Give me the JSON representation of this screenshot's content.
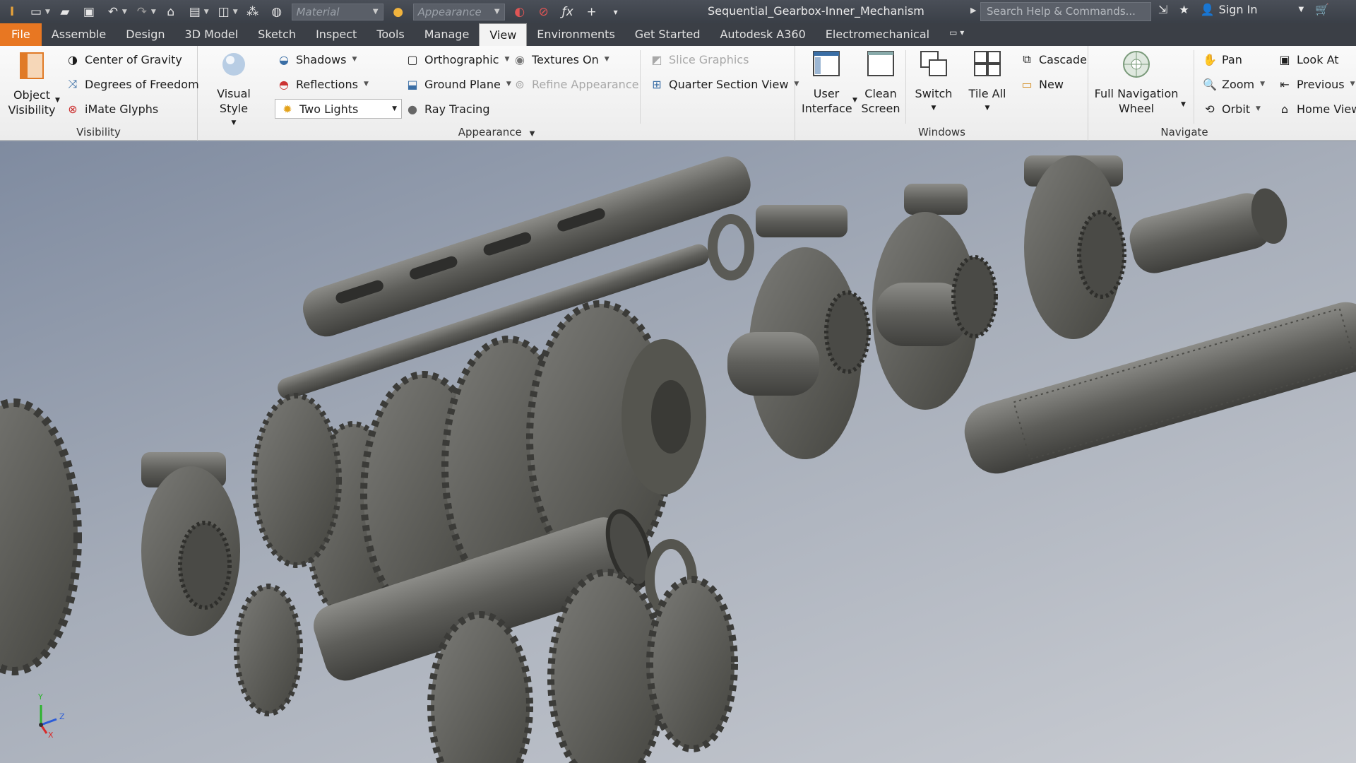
{
  "window": {
    "document_title": "Sequential_Gearbox-Inner_Mechanism",
    "search_placeholder": "Search Help & Commands...",
    "sign_in": "Sign In"
  },
  "quick_access": {
    "material_placeholder": "Material",
    "appearance_placeholder": "Appearance",
    "icons": [
      "app-logo-icon",
      "new-file-icon",
      "open-icon",
      "save-icon",
      "undo-icon",
      "redo-icon",
      "home-icon",
      "print-icon",
      "measure-icon",
      "select-icon",
      "globe-icon",
      "color-wheel-icon",
      "adjust-icon",
      "clear-icon",
      "fx-icon",
      "plus-icon",
      "customize-icon"
    ]
  },
  "tabs": [
    {
      "label": "File"
    },
    {
      "label": "Assemble"
    },
    {
      "label": "Design"
    },
    {
      "label": "3D Model"
    },
    {
      "label": "Sketch"
    },
    {
      "label": "Inspect"
    },
    {
      "label": "Tools"
    },
    {
      "label": "Manage"
    },
    {
      "label": "View"
    },
    {
      "label": "Environments"
    },
    {
      "label": "Get Started"
    },
    {
      "label": "Autodesk A360"
    },
    {
      "label": "Electromechanical"
    }
  ],
  "active_tab": "View",
  "ribbon": {
    "visibility": {
      "label": "Visibility",
      "object_visibility": "Object",
      "object_visibility_2": "Visibility",
      "center_of_gravity": "Center of Gravity",
      "degrees_of_freedom": "Degrees of Freedom",
      "imate_glyphs": "iMate Glyphs"
    },
    "appearance": {
      "label": "Appearance",
      "visual_style": "Visual Style",
      "shadows": "Shadows",
      "reflections": "Reflections",
      "lighting": "Two Lights",
      "orthographic": "Orthographic",
      "ground_plane": "Ground Plane",
      "ray_tracing": "Ray Tracing",
      "textures_on": "Textures On",
      "refine_appearance": "Refine Appearance",
      "slice_graphics": "Slice Graphics",
      "quarter_section_view": "Quarter Section View"
    },
    "windows": {
      "label": "Windows",
      "user_interface": "User",
      "user_interface_2": "Interface",
      "clean_screen": "Clean",
      "clean_screen_2": "Screen",
      "switch": "Switch",
      "tile_all": "Tile All",
      "cascade": "Cascade",
      "new": "New"
    },
    "navigate": {
      "label": "Navigate",
      "full_nav_wheel": "Full Navigation",
      "full_nav_wheel_2": "Wheel",
      "pan": "Pan",
      "zoom": "Zoom",
      "orbit": "Orbit",
      "look_at": "Look At",
      "previous": "Previous",
      "home_view": "Home View"
    }
  },
  "viewport": {
    "axis_x": "X",
    "axis_y": "Y",
    "axis_z": "Z"
  },
  "colors": {
    "file_tab": "#e87722",
    "titlebar": "#3a3f47",
    "part_metal": "#6e6e6a"
  }
}
